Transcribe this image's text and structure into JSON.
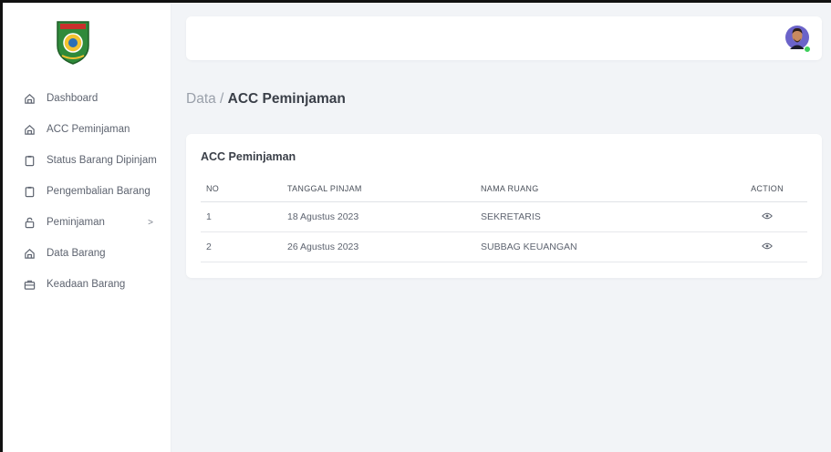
{
  "sidebar": {
    "items": [
      {
        "label": "Dashboard",
        "icon": "home-icon"
      },
      {
        "label": "ACC Peminjaman",
        "icon": "home-icon"
      },
      {
        "label": "Status Barang Dipinjam",
        "icon": "clipboard-icon"
      },
      {
        "label": "Pengembalian Barang",
        "icon": "clipboard-icon"
      },
      {
        "label": "Peminjaman",
        "icon": "lock-icon",
        "chevron": ">"
      },
      {
        "label": "Data Barang",
        "icon": "home-icon"
      },
      {
        "label": "Keadaan Barang",
        "icon": "briefcase-icon"
      }
    ]
  },
  "breadcrumb": {
    "parent": "Data /",
    "current": "ACC Peminjaman"
  },
  "card": {
    "title": "ACC Peminjaman",
    "columns": {
      "no": "NO",
      "date": "TANGGAL PINJAM",
      "room": "NAMA RUANG",
      "action": "ACTION"
    },
    "rows": [
      {
        "no": "1",
        "date": "18 Agustus 2023",
        "room": "SEKRETARIS"
      },
      {
        "no": "2",
        "date": "26 Agustus 2023",
        "room": "SUBBAG KEUANGAN"
      }
    ]
  },
  "colors": {
    "accent_green": "#3ecf5b",
    "text": "#5e6470",
    "background": "#f2f4f7"
  }
}
